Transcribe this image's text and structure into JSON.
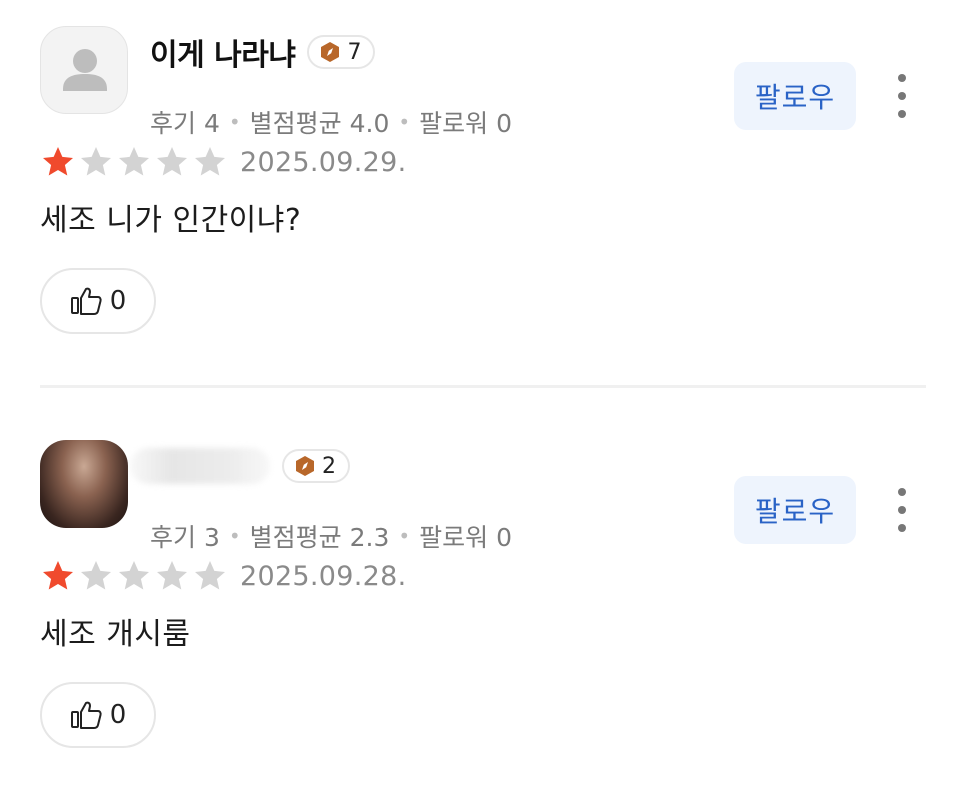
{
  "reviews": [
    {
      "username": "이게 나라냐",
      "level": "7",
      "stats": {
        "reviews": "후기 4",
        "avg_rating": "별점평균 4.0",
        "followers": "팔로워 0"
      },
      "follow_label": "팔로우",
      "rating": 1,
      "max_rating": 5,
      "date": "2025.09.29.",
      "text": "세조 니가 인간이냐?",
      "likes": "0"
    },
    {
      "username": "",
      "level": "2",
      "stats": {
        "reviews": "후기 3",
        "avg_rating": "별점평균 2.3",
        "followers": "팔로워 0"
      },
      "follow_label": "팔로우",
      "rating": 1,
      "max_rating": 5,
      "date": "2025.09.28.",
      "text": "세조 개시룸",
      "likes": "0"
    }
  ],
  "colors": {
    "star_filled": "#f04a2d",
    "star_empty": "#d3d3d3",
    "follow_text": "#2a63c6",
    "follow_bg": "#eef4fd",
    "badge_icon": "#b8672a"
  },
  "icons": {
    "avatar_default": "person-silhouette-icon",
    "level": "compass-badge-icon",
    "more": "vertical-ellipsis-icon",
    "like": "thumbs-up-icon",
    "star": "star-icon"
  }
}
